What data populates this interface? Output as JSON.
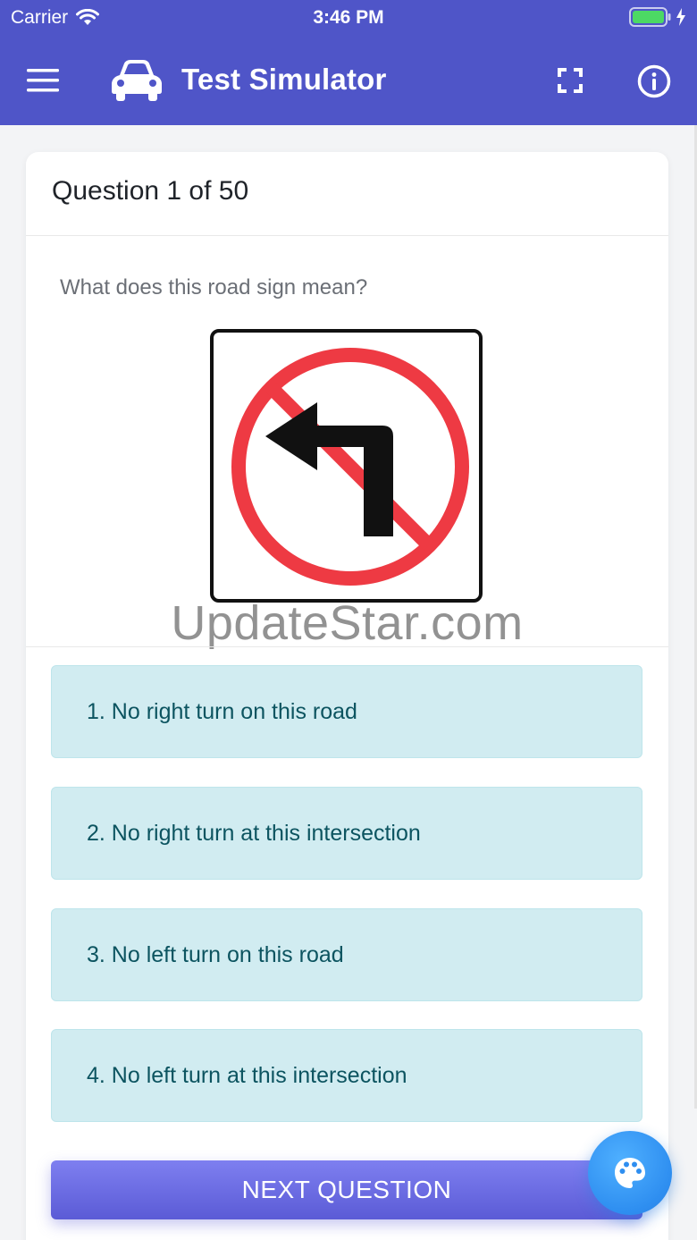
{
  "status_bar": {
    "carrier": "Carrier",
    "time": "3:46 PM"
  },
  "app_bar": {
    "title": "Test Simulator"
  },
  "card": {
    "header": "Question 1 of 50",
    "question": "What does this road sign mean?",
    "watermark": "UpdateStar.com",
    "answers": [
      {
        "label": "1. No right turn on this road"
      },
      {
        "label": "2. No right turn at this intersection"
      },
      {
        "label": "3. No left turn on this road"
      },
      {
        "label": "4. No left turn at this intersection"
      }
    ]
  },
  "next_button": {
    "label": "NEXT QUESTION"
  },
  "colors": {
    "primary": "#4f55c8",
    "answer_bg": "#d1ecf1",
    "answer_text": "#0c5460",
    "sign_red": "#ee3a43",
    "fab": "#2e8ef0"
  },
  "icons": [
    "menu-icon",
    "car-icon",
    "fullscreen-icon",
    "info-icon",
    "palette-icon",
    "wifi-icon",
    "battery-icon",
    "charging-icon"
  ]
}
